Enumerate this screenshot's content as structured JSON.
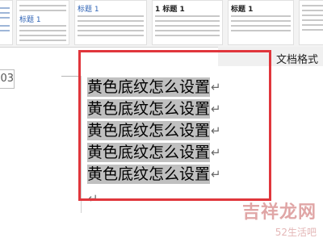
{
  "style_gallery": {
    "cards": [
      {
        "title": ""
      },
      {
        "title": "标题 1"
      },
      {
        "title": "标题 1"
      },
      {
        "title": "1 标题 1"
      },
      {
        "title": "标题 1"
      },
      {
        "title": ""
      }
    ]
  },
  "ribbon": {
    "tab_label": "文档格式"
  },
  "page": {
    "number": "03"
  },
  "document": {
    "lines": [
      "黄色底纹怎么设置",
      "黄色底纹怎么设置",
      "黄色底纹怎么设置",
      "黄色底纹怎么设置",
      "黄色底纹怎么设置"
    ],
    "paragraph_mark": "↵"
  },
  "watermark": {
    "brand": "吉祥龙网",
    "sub": "52生活吧"
  },
  "colors": {
    "highlight": "#c0c0c0",
    "annotation_box": "#e0363c",
    "heading_blue": "#2f63b5"
  }
}
